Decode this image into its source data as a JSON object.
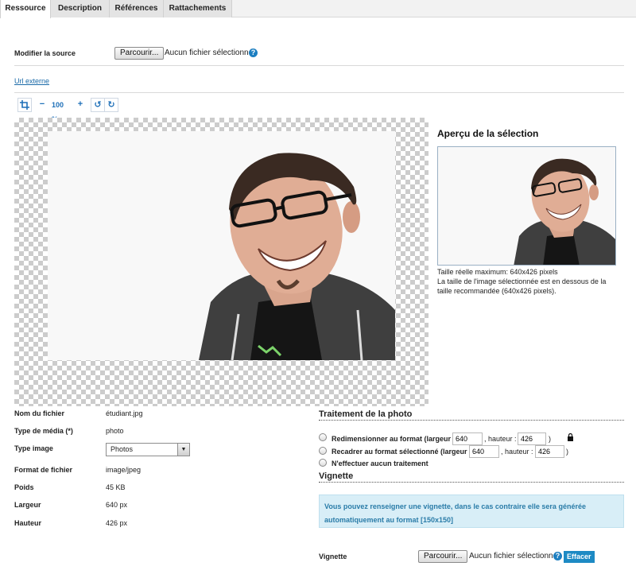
{
  "tabs": [
    "Ressource",
    "Description",
    "Références",
    "Rattachements"
  ],
  "source": {
    "label": "Modifier la source",
    "browse_button": "Parcourir...",
    "no_file": "Aucun fichier sélectionné.",
    "help": "?"
  },
  "external_url_link": "Url externe",
  "toolbar": {
    "crop": "⛶",
    "zoom_out": "−",
    "zoom_level": "100 %",
    "zoom_in": "+",
    "rotate_left": "↺",
    "rotate_right": "↻"
  },
  "preview": {
    "title": "Aperçu de la sélection",
    "info_line1": "Taille réelle maximum: 640x426 pixels",
    "info_line2": "La taille de l'image sélectionnée est en dessous de la taille recommandée (640x426 pixels)."
  },
  "file_info": {
    "rows": [
      {
        "label": "Nom du fichier",
        "value": "étudiant.jpg"
      },
      {
        "label": "Type de média (*)",
        "value": "photo"
      },
      {
        "label": "Type image",
        "value": "Photos"
      },
      {
        "label": "Format de fichier",
        "value": "image/jpeg"
      },
      {
        "label": "Poids",
        "value": "45 KB"
      },
      {
        "label": "Largeur",
        "value": "640 px"
      },
      {
        "label": "Hauteur",
        "value": "426 px"
      }
    ]
  },
  "processing": {
    "title": "Traitement de la photo",
    "options": [
      {
        "label": "Redimensionner au format (largeur :",
        "width": "640",
        "height_label": ", hauteur :",
        "height": "426",
        "close": ")"
      },
      {
        "label": "Recadrer au format sélectionné (largeur :",
        "width": "640",
        "height_label": ", hauteur :",
        "height": "426",
        "close": ")"
      },
      {
        "label": "N'effectuer aucun traitement"
      }
    ]
  },
  "vignette": {
    "title": "Vignette",
    "info_line1": "Vous pouvez renseigner une vignette, dans le cas contraire elle sera générée",
    "info_line2": "automatiquement au format [150x150]",
    "label": "Vignette",
    "browse_button": "Parcourir...",
    "no_file": "Aucun fichier sélectionné.",
    "help": "?",
    "clear_button": "Effacer"
  },
  "colors": {
    "accent": "#1d8ac4",
    "link": "#1a6aa8",
    "info_bg": "#d8eef7"
  }
}
